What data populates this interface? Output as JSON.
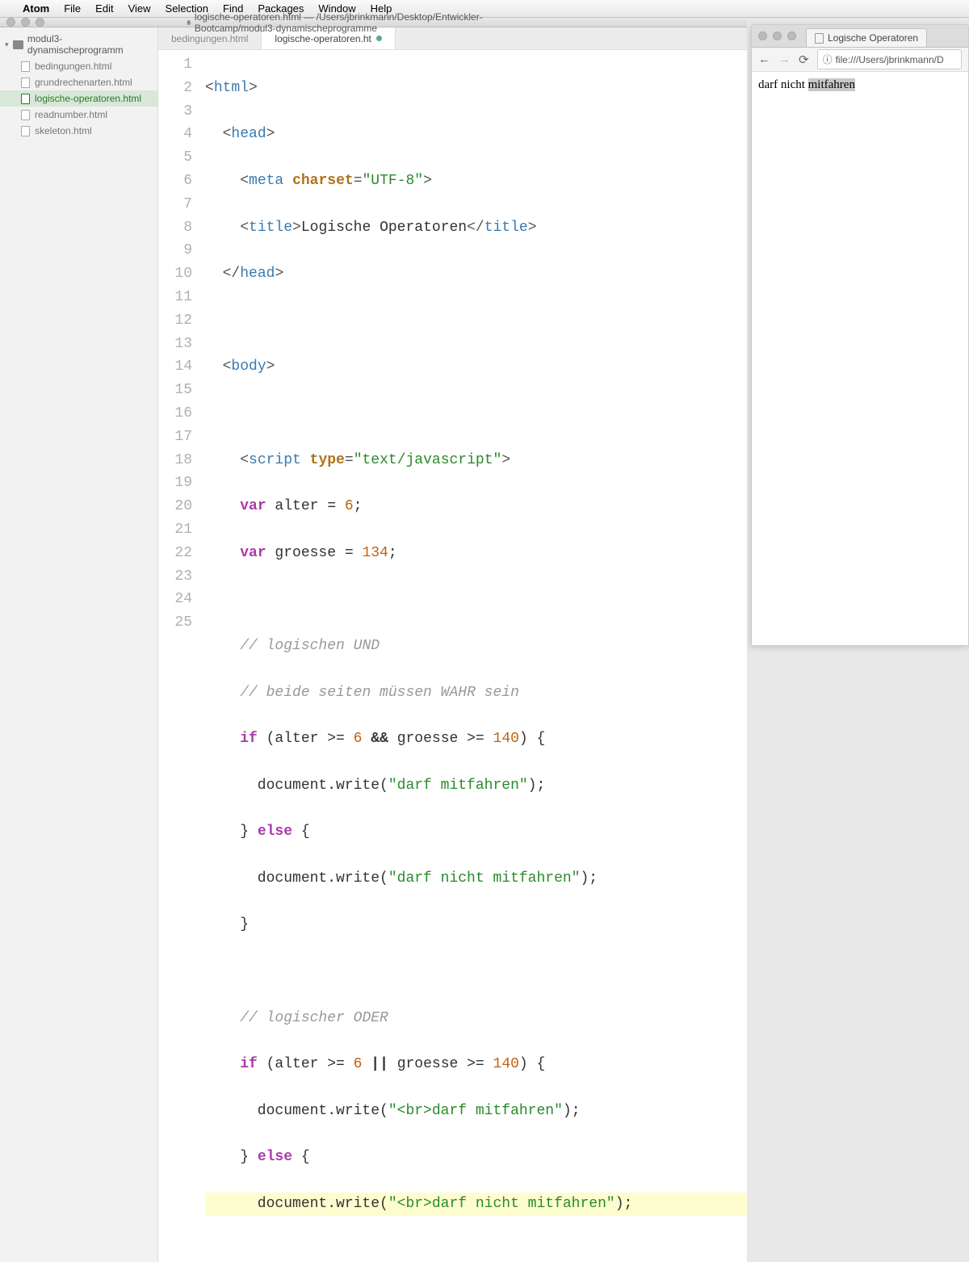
{
  "menubar": {
    "app": "Atom",
    "items": [
      "File",
      "Edit",
      "View",
      "Selection",
      "Find",
      "Packages",
      "Window",
      "Help"
    ]
  },
  "atom": {
    "title": "logische-operatoren.html — /Users/jbrinkmann/Desktop/Entwickler-Bootcamp/modul3-dynamischeprogramme",
    "tree_root": "modul3-dynamischeprogramm",
    "tree_files": [
      {
        "name": "bedingungen.html",
        "active": false
      },
      {
        "name": "grundrechenarten.html",
        "active": false
      },
      {
        "name": "logische-operatoren.html",
        "active": true
      },
      {
        "name": "readnumber.html",
        "active": false
      },
      {
        "name": "skeleton.html",
        "active": false
      }
    ],
    "tabs": [
      {
        "label": "bedingungen.html",
        "active": false,
        "modified": false
      },
      {
        "label": "logische-operatoren.ht",
        "active": true,
        "modified": true
      }
    ],
    "line_count": 25
  },
  "code": {
    "l1_tag": "html",
    "l2_tag": "head",
    "l3_tag": "meta",
    "l3_attr": "charset",
    "l3_val": "\"UTF-8\"",
    "l4_tag": "title",
    "l4_text": "Logische Operatoren",
    "l5_tag": "head",
    "l7_tag": "body",
    "l9_tag": "script",
    "l9_attr": "type",
    "l9_val": "\"text/javascript\"",
    "l10_kw": "var",
    "l10_name": " alter = ",
    "l10_num": "6",
    "l11_kw": "var",
    "l11_name": " groesse = ",
    "l11_num": "134",
    "l13_cmt": "// logischen UND",
    "l14_cmt": "// beide seiten müssen WAHR sein",
    "l15_kw": "if",
    "l15_expr_a": " (alter >= ",
    "l15_n1": "6",
    "l15_op": " && ",
    "l15_expr_b": "groesse >= ",
    "l15_n2": "140",
    "l15_end": ") {",
    "l16_call": "      document.write(",
    "l16_str": "\"darf mitfahren\"",
    "l16_end": ");",
    "l17_a": "    } ",
    "l17_kw": "else",
    "l17_b": " {",
    "l18_call": "      document.write(",
    "l18_str": "\"darf nicht mitfahren\"",
    "l18_end": ");",
    "l19": "    }",
    "l21_cmt": "// logischer ODER",
    "l22_kw": "if",
    "l22_expr_a": " (alter >= ",
    "l22_n1": "6",
    "l22_op": " || ",
    "l22_expr_b": "groesse >= ",
    "l22_n2": "140",
    "l22_end": ") {",
    "l23_call": "      document.write(",
    "l23_str": "\"<br>darf mitfahren\"",
    "l23_end": ");",
    "l24_a": "    } ",
    "l24_kw": "else",
    "l24_b": " {",
    "l25_call": "      document.write(",
    "l25_str": "\"<br>darf nicht mitfahren\"",
    "l25_end": ");"
  },
  "browser": {
    "tab_title": "Logische Operatoren",
    "url": "file:///Users/jbrinkmann/D",
    "output_a": "darf nicht ",
    "output_sel": "mitfahren"
  }
}
